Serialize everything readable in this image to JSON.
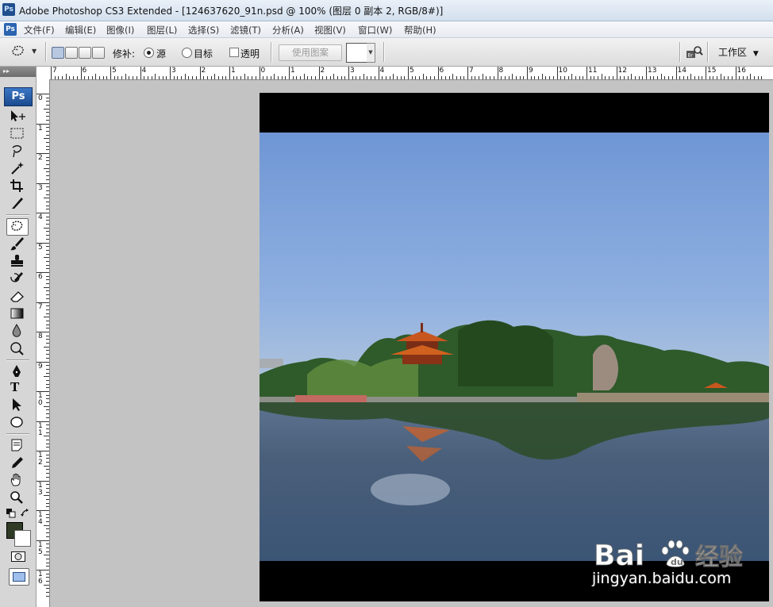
{
  "window": {
    "title": "Adobe Photoshop CS3 Extended - [124637620_91n.psd @ 100% (图层 0 副本 2, RGB/8#)]",
    "app_icon_text": "Ps"
  },
  "menubar": {
    "items": [
      "文件(F)",
      "编辑(E)",
      "图像(I)",
      "图层(L)",
      "选择(S)",
      "滤镜(T)",
      "分析(A)",
      "视图(V)",
      "窗口(W)",
      "帮助(H)"
    ]
  },
  "options_bar": {
    "patch_label": "修补:",
    "source_label": "源",
    "destination_label": "目标",
    "transparent_label": "透明",
    "use_pattern_label": "使用图案",
    "workspace_label": "工作区",
    "patch_mode": "source",
    "transparent_checked": false
  },
  "toolbox": {
    "logo_text": "Ps",
    "active_tool": "patch-tool",
    "foreground_color": "#2f3b24",
    "background_color": "#ffffff"
  },
  "rulers": {
    "horizontal": [
      "7",
      "6",
      "5",
      "4",
      "3",
      "2",
      "1",
      "0",
      "1",
      "2",
      "3",
      "4",
      "5",
      "6",
      "7",
      "8",
      "9",
      "10",
      "11",
      "12",
      "13",
      "14",
      "15",
      "16"
    ],
    "vertical": [
      "0",
      "1",
      "2",
      "3",
      "4",
      "5",
      "6",
      "7",
      "8",
      "9",
      "1 0",
      "1 1",
      "1 2",
      "1 3",
      "1 4",
      "1 5",
      "1 6"
    ]
  },
  "document": {
    "zoom": "100%",
    "layer": "图层 0 副本 2",
    "mode": "RGB/8#"
  },
  "watermark": {
    "brand": "Bai经验",
    "url": "jingyan.baidu.com"
  }
}
